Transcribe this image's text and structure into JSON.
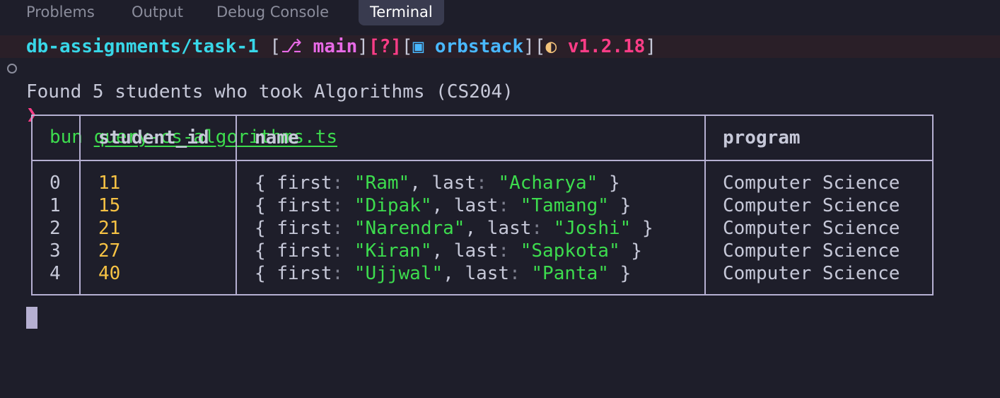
{
  "tabs": [
    {
      "label": "Problems",
      "active": false
    },
    {
      "label": "Output",
      "active": false
    },
    {
      "label": "Debug Console",
      "active": false
    },
    {
      "label": "Terminal",
      "active": true
    }
  ],
  "prompt": {
    "directory": "db-assignments/task-1",
    "branch_icon": "git-branch-icon",
    "branch": "main",
    "git_status": "[?]",
    "context_icon": "docker-context-icon",
    "context": "orbstack",
    "runtime_icon": "bun-icon",
    "runtime_version": "v1.2.18"
  },
  "command": {
    "symbol": "❯",
    "program": "bun",
    "argument": "query-cs-algorithms.ts"
  },
  "output_message": "Found 5 students who took Algorithms (CS204)",
  "table": {
    "headers": [
      "",
      "student_id",
      "name",
      "program"
    ],
    "rows": [
      {
        "index": "0",
        "student_id": "11",
        "first": "\"Ram\"",
        "last": "\"Acharya\"",
        "program": "Computer Science"
      },
      {
        "index": "1",
        "student_id": "15",
        "first": "\"Dipak\"",
        "last": "\"Tamang\"",
        "program": "Computer Science"
      },
      {
        "index": "2",
        "student_id": "21",
        "first": "\"Narendra\"",
        "last": "\"Joshi\"",
        "program": "Computer Science"
      },
      {
        "index": "3",
        "student_id": "27",
        "first": "\"Kiran\"",
        "last": "\"Sapkota\"",
        "program": "Computer Science"
      },
      {
        "index": "4",
        "student_id": "40",
        "first": "\"Ujjwal\"",
        "last": "\"Panta\"",
        "program": "Computer Science"
      }
    ],
    "name_tokens": {
      "open_brace": "{",
      "first_key": "first",
      "colon": ":",
      "comma": ",",
      "last_key": "last",
      "close_brace": "}"
    }
  },
  "colors": {
    "background": "#1e1e2a",
    "directory": "#38d7e8",
    "branch": "#e86ae6",
    "accent_pink": "#ff3d87",
    "context": "#49b8ff",
    "string_green": "#3ddc4e",
    "number_yellow": "#f6c244",
    "table_border": "#b6b0d2"
  }
}
